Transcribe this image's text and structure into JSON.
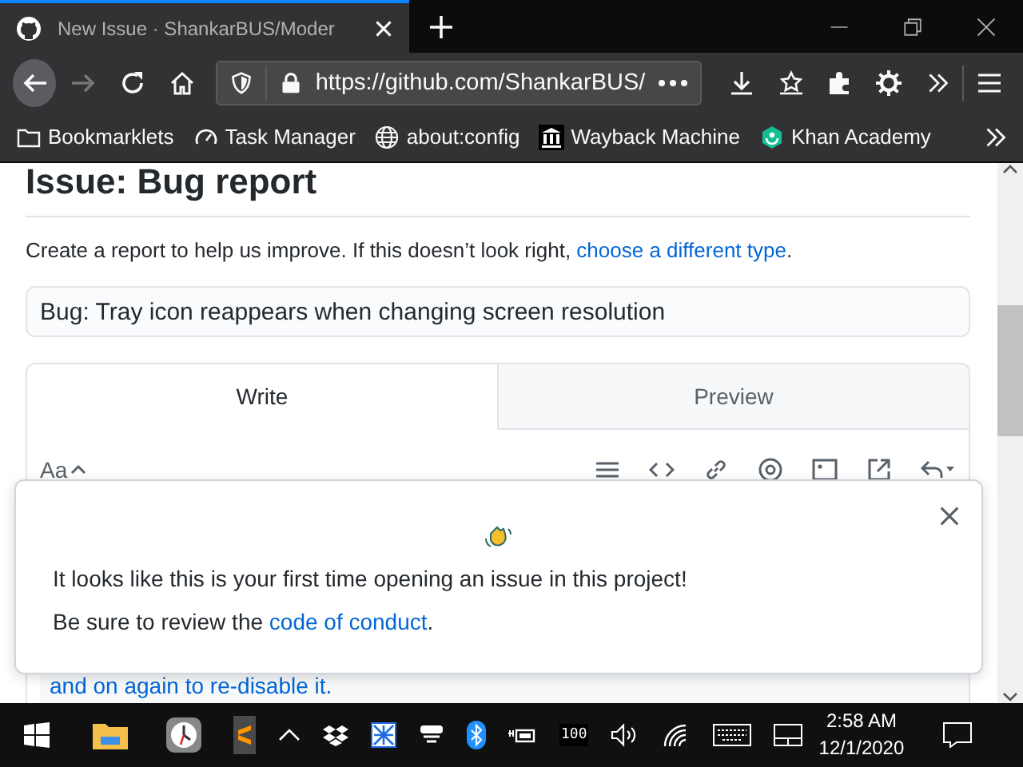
{
  "browser": {
    "tab": {
      "title": "New Issue · ShankarBUS/Moder",
      "selected": true
    },
    "url": "https://github.com/ShankarBUS/",
    "forward_disabled": true,
    "bookmarks": [
      {
        "label": "Bookmarklets",
        "kind": "folder"
      },
      {
        "label": "Task Manager",
        "kind": "gauge"
      },
      {
        "label": "about:config",
        "kind": "globe"
      },
      {
        "label": "Wayback Machine",
        "kind": "wayback"
      },
      {
        "label": "Khan Academy",
        "kind": "khan"
      }
    ]
  },
  "page": {
    "heading": "Issue: Bug report",
    "intro": {
      "text": "Create a report to help us improve. If this doesn’t look right, ",
      "link": "choose a different type",
      "after": "."
    },
    "title_field": {
      "value": "Bug: Tray icon reappears when changing screen resolution"
    },
    "editor_tabs": [
      {
        "label": "Write",
        "selected": true
      },
      {
        "label": "Preview",
        "selected": false
      }
    ],
    "text_style": "Aa",
    "body_text": "and on again to re-disable it."
  },
  "popup": {
    "message": "It looks like this is your first time opening an issue in this project!",
    "conduct": {
      "text": "Be sure to review the ",
      "link": "code of conduct",
      "after": "."
    }
  },
  "taskbar": {
    "battery_label": "100",
    "time": "2:58 AM",
    "date": "12/1/2020"
  }
}
